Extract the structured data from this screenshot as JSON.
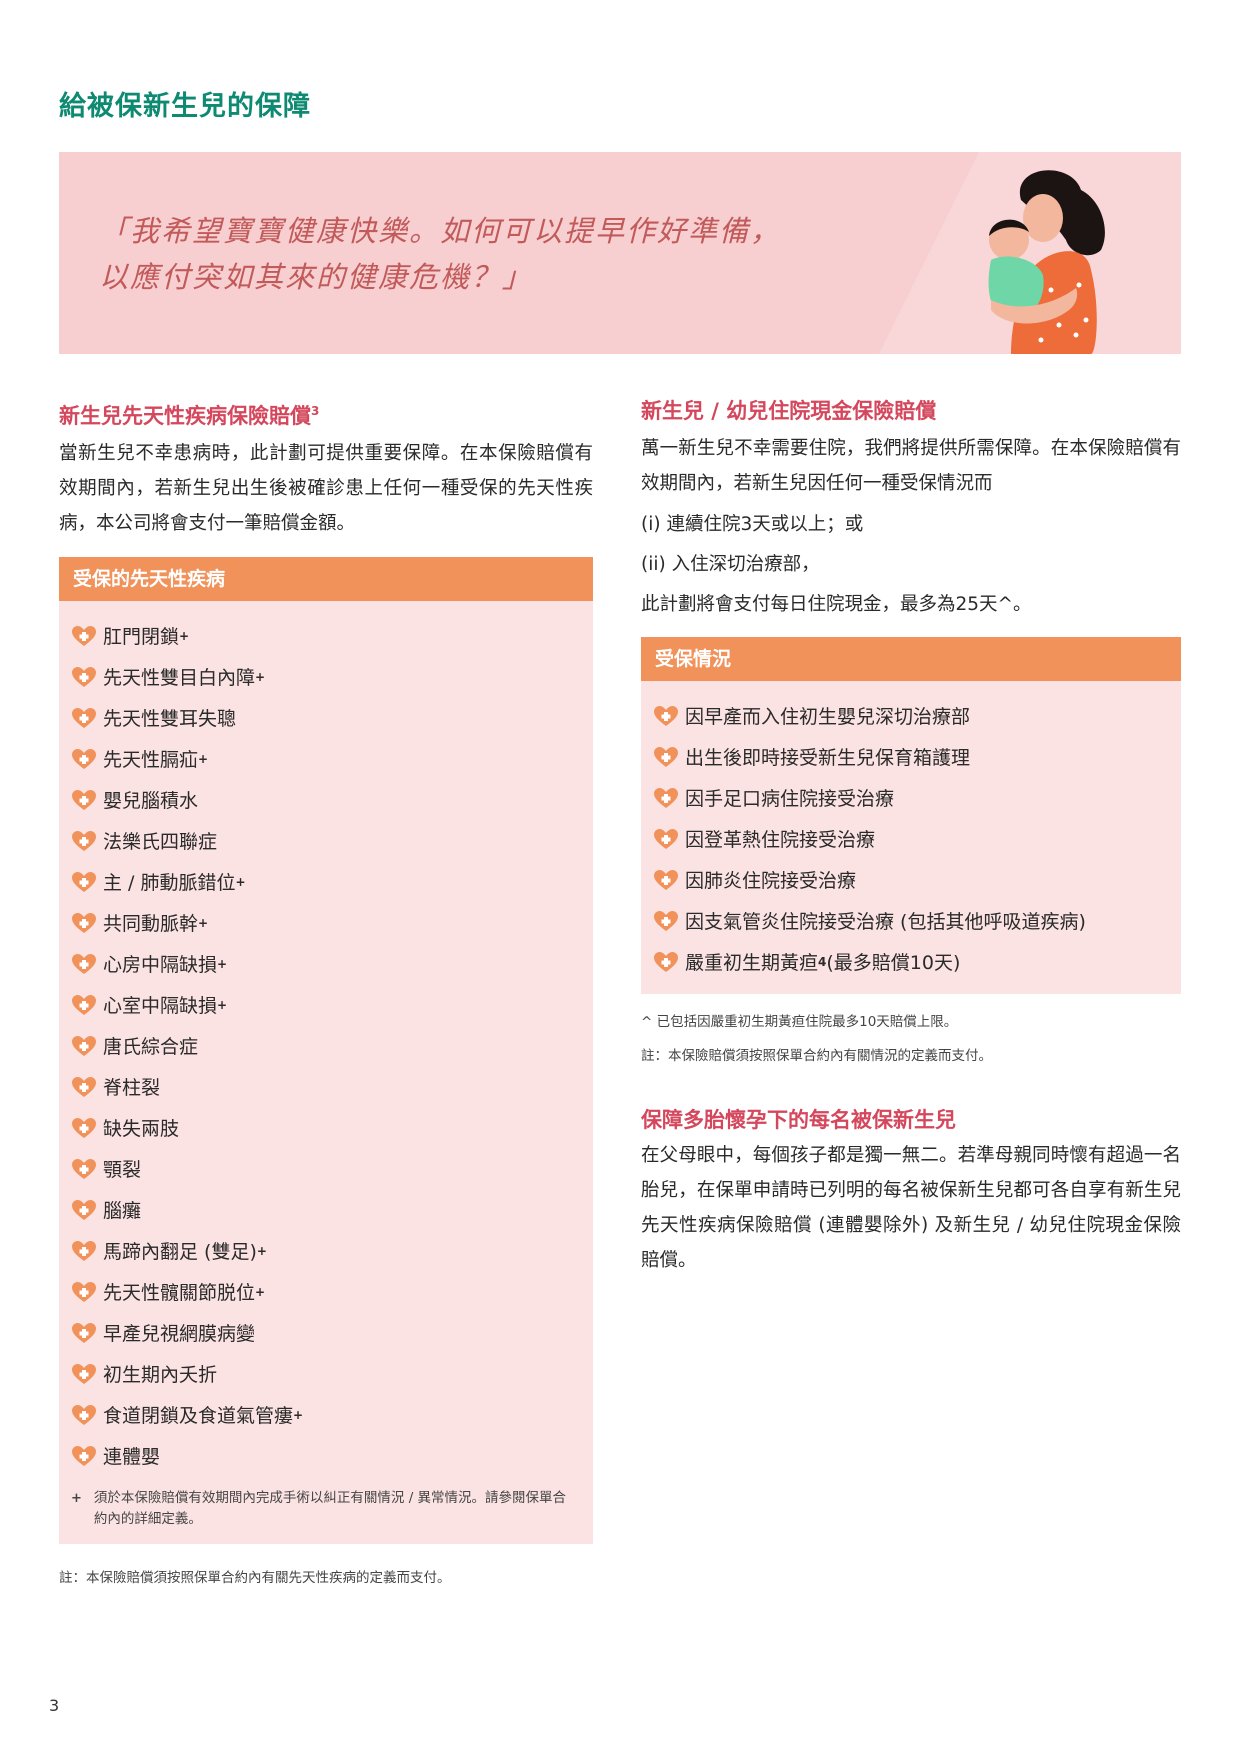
{
  "page": {
    "title": "給被保新生兒的保障",
    "page_number": "3"
  },
  "hero": {
    "quote_line1": "「我希望寶寶健康快樂。如何可以提早作好準備，",
    "quote_line2": "以應付突如其來的健康危機？」"
  },
  "left": {
    "title": "新生兒先天性疾病保險賠償",
    "title_sup": "3",
    "description": "當新生兒不幸患病時，此計劃可提供重要保障。在本保險賠償有效期間內，若新生兒出生後被確診患上任何一種受保的先天性疾病，本公司將會支付一筆賠償金額。",
    "panel_title": "受保的先天性疾病",
    "conditions": [
      {
        "label": "肛門閉鎖",
        "sup": "+"
      },
      {
        "label": "先天性雙目白內障",
        "sup": "+"
      },
      {
        "label": "先天性雙耳失聰",
        "sup": ""
      },
      {
        "label": "先天性膈疝",
        "sup": "+"
      },
      {
        "label": "嬰兒腦積水",
        "sup": ""
      },
      {
        "label": "法樂氏四聯症",
        "sup": ""
      },
      {
        "label": "主 / 肺動脈錯位",
        "sup": "+"
      },
      {
        "label": "共同動脈幹",
        "sup": "+"
      },
      {
        "label": "心房中隔缺損",
        "sup": "+"
      },
      {
        "label": "心室中隔缺損",
        "sup": "+"
      },
      {
        "label": "唐氏綜合症",
        "sup": ""
      },
      {
        "label": "脊柱裂",
        "sup": ""
      },
      {
        "label": "缺失兩肢",
        "sup": ""
      },
      {
        "label": "顎裂",
        "sup": ""
      },
      {
        "label": "腦癱",
        "sup": ""
      },
      {
        "label": "馬蹄內翻足 (雙足)",
        "sup": "+"
      },
      {
        "label": "先天性髖關節脱位",
        "sup": "+"
      },
      {
        "label": "早產兒視網膜病變",
        "sup": ""
      },
      {
        "label": "初生期內夭折",
        "sup": ""
      },
      {
        "label": "食道閉鎖及食道氣管瘻",
        "sup": "+"
      },
      {
        "label": "連體嬰",
        "sup": ""
      }
    ],
    "footnote_mark": "+",
    "footnote": "須於本保險賠償有效期間內完成手術以糾正有關情況 / 異常情況。請參閱保單合約內的詳細定義。",
    "note": "註：本保險賠償須按照保單合約內有關先天性疾病的定義而支付。"
  },
  "right": {
    "title": "新生兒 / 幼兒住院現金保險賠償",
    "description": "萬一新生兒不幸需要住院，我們將提供所需保障。在本保險賠償有效期間內，若新生兒因任何一種受保情況而",
    "item1": "(i)  連續住院3天或以上；或",
    "item2": "(ii) 入住深切治療部，",
    "item3": "此計劃將會支付每日住院現金，最多為25天^。",
    "panel_title": "受保情況",
    "situations": [
      {
        "label": "因早產而入住初生嬰兒深切治療部",
        "sup": "",
        "suffix": ""
      },
      {
        "label": "出生後即時接受新生兒保育箱護理",
        "sup": "",
        "suffix": ""
      },
      {
        "label": "因手足口病住院接受治療",
        "sup": "",
        "suffix": ""
      },
      {
        "label": "因登革熱住院接受治療",
        "sup": "",
        "suffix": ""
      },
      {
        "label": "因肺炎住院接受治療",
        "sup": "",
        "suffix": ""
      },
      {
        "label": "因支氣管炎住院接受治療 (包括其他呼吸道疾病)",
        "sup": "",
        "suffix": ""
      },
      {
        "label": "嚴重初生期黃疸",
        "sup": "4",
        "suffix": " (最多賠償10天)"
      }
    ],
    "caret_note": "^ 已包括因嚴重初生期黃疸住院最多10天賠償上限。",
    "note": "註：本保險賠償須按照保單合約內有關情況的定義而支付。",
    "multi_title": "保障多胎懷孕下的每名被保新生兒",
    "multi_description": "在父母眼中，每個孩子都是獨一無二。若準母親同時懷有超過一名胎兒，在保單申請時已列明的每名被保新生兒都可各自享有新生兒先天性疾病保險賠償 (連體嬰除外) 及新生兒 / 幼兒住院現金保險賠償。"
  },
  "colors": {
    "title_green": "#0e8a72",
    "section_pink": "#d4475c",
    "panel_orange": "#f0925a",
    "panel_bg": "#fbe3e3",
    "hero_bg": "#f9d6d7",
    "heart_icon": "#f0925a"
  },
  "icons": {
    "list_bullet": "heart-cross-icon",
    "hero_art": "mother-and-baby-illustration"
  }
}
